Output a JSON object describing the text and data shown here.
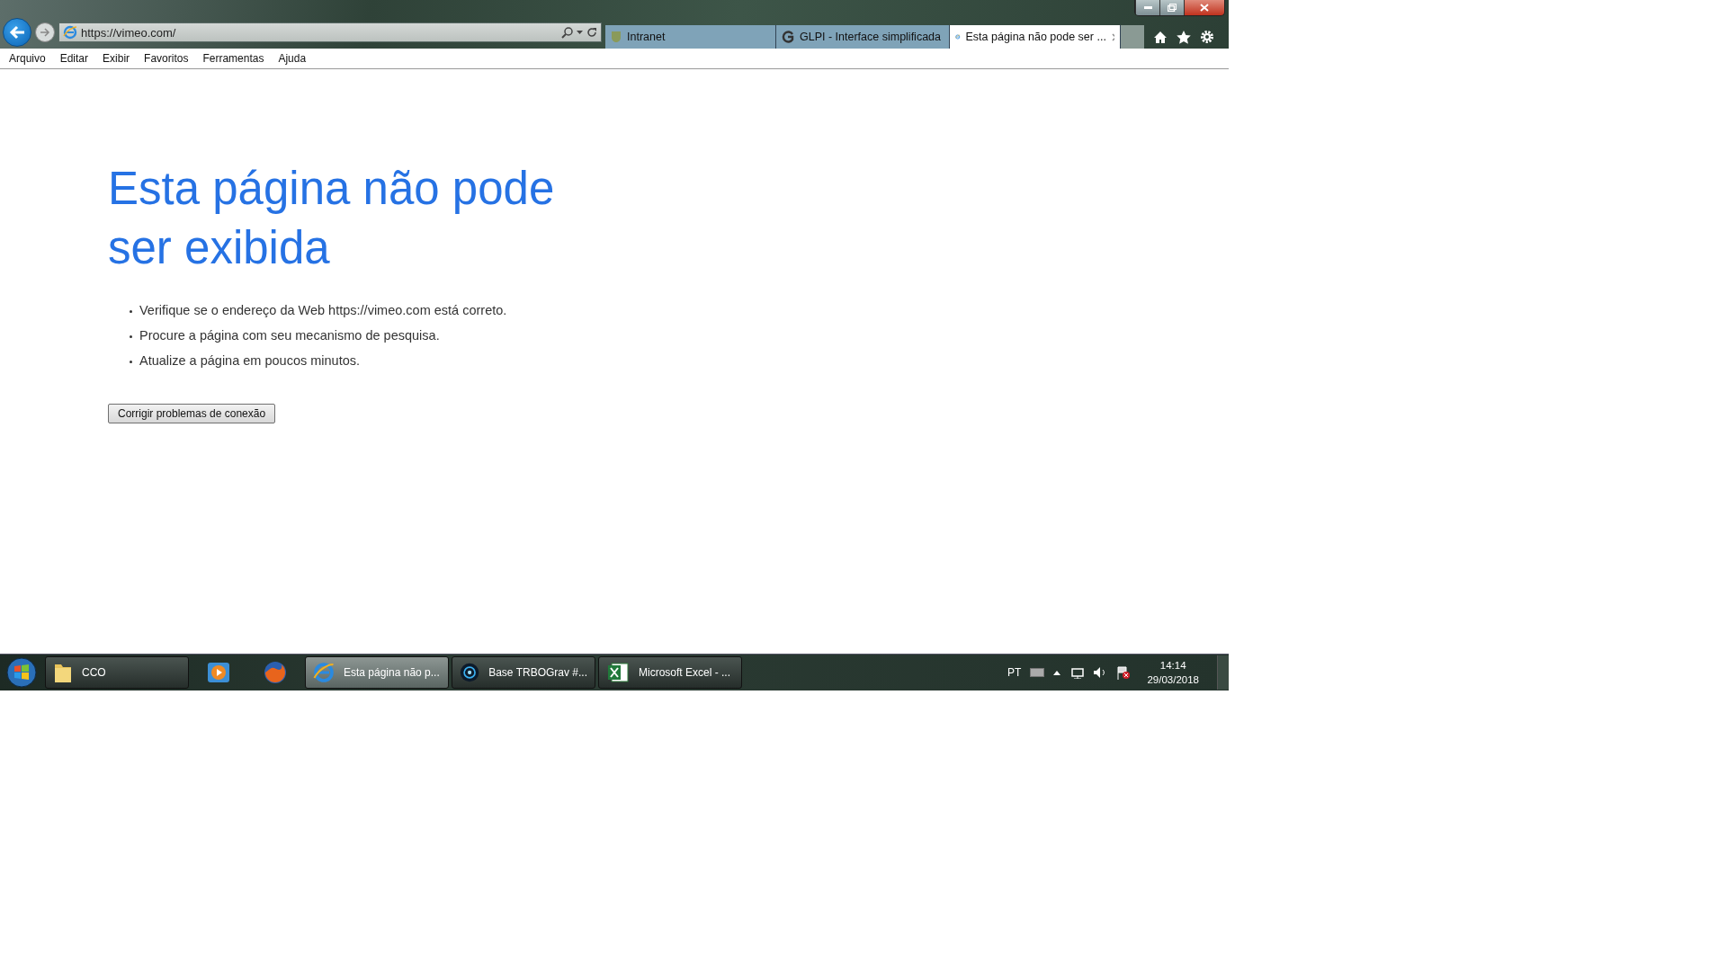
{
  "address_bar": {
    "url": "https://vimeo.com/"
  },
  "tabs": [
    {
      "label": "Intranet",
      "selected": false
    },
    {
      "label": "GLPI - Interface simplificada",
      "selected": false
    },
    {
      "label": "Esta página não pode ser ...",
      "selected": true
    }
  ],
  "menu": [
    "Arquivo",
    "Editar",
    "Exibir",
    "Favoritos",
    "Ferramentas",
    "Ajuda"
  ],
  "page": {
    "heading": "Esta página não pode ser exibida",
    "bullets": [
      "Verifique se o endereço da Web https://vimeo.com está correto.",
      "Procure a página com seu mecanismo de pesquisa.",
      "Atualize a página em poucos minutos."
    ],
    "button": "Corrigir problemas de conexão"
  },
  "taskbar": {
    "items": [
      {
        "kind": "folder",
        "label": "CCO",
        "selected": false
      },
      {
        "kind": "pinned"
      },
      {
        "kind": "pinned"
      },
      {
        "kind": "window",
        "label": "Esta página não p...",
        "selected": true
      },
      {
        "kind": "window",
        "label": "Base TRBOGrav #...",
        "selected": false
      },
      {
        "kind": "window",
        "label": "Microsoft Excel - ...",
        "selected": false
      }
    ],
    "language": "PT",
    "time": "14:14",
    "date": "29/03/2018"
  }
}
